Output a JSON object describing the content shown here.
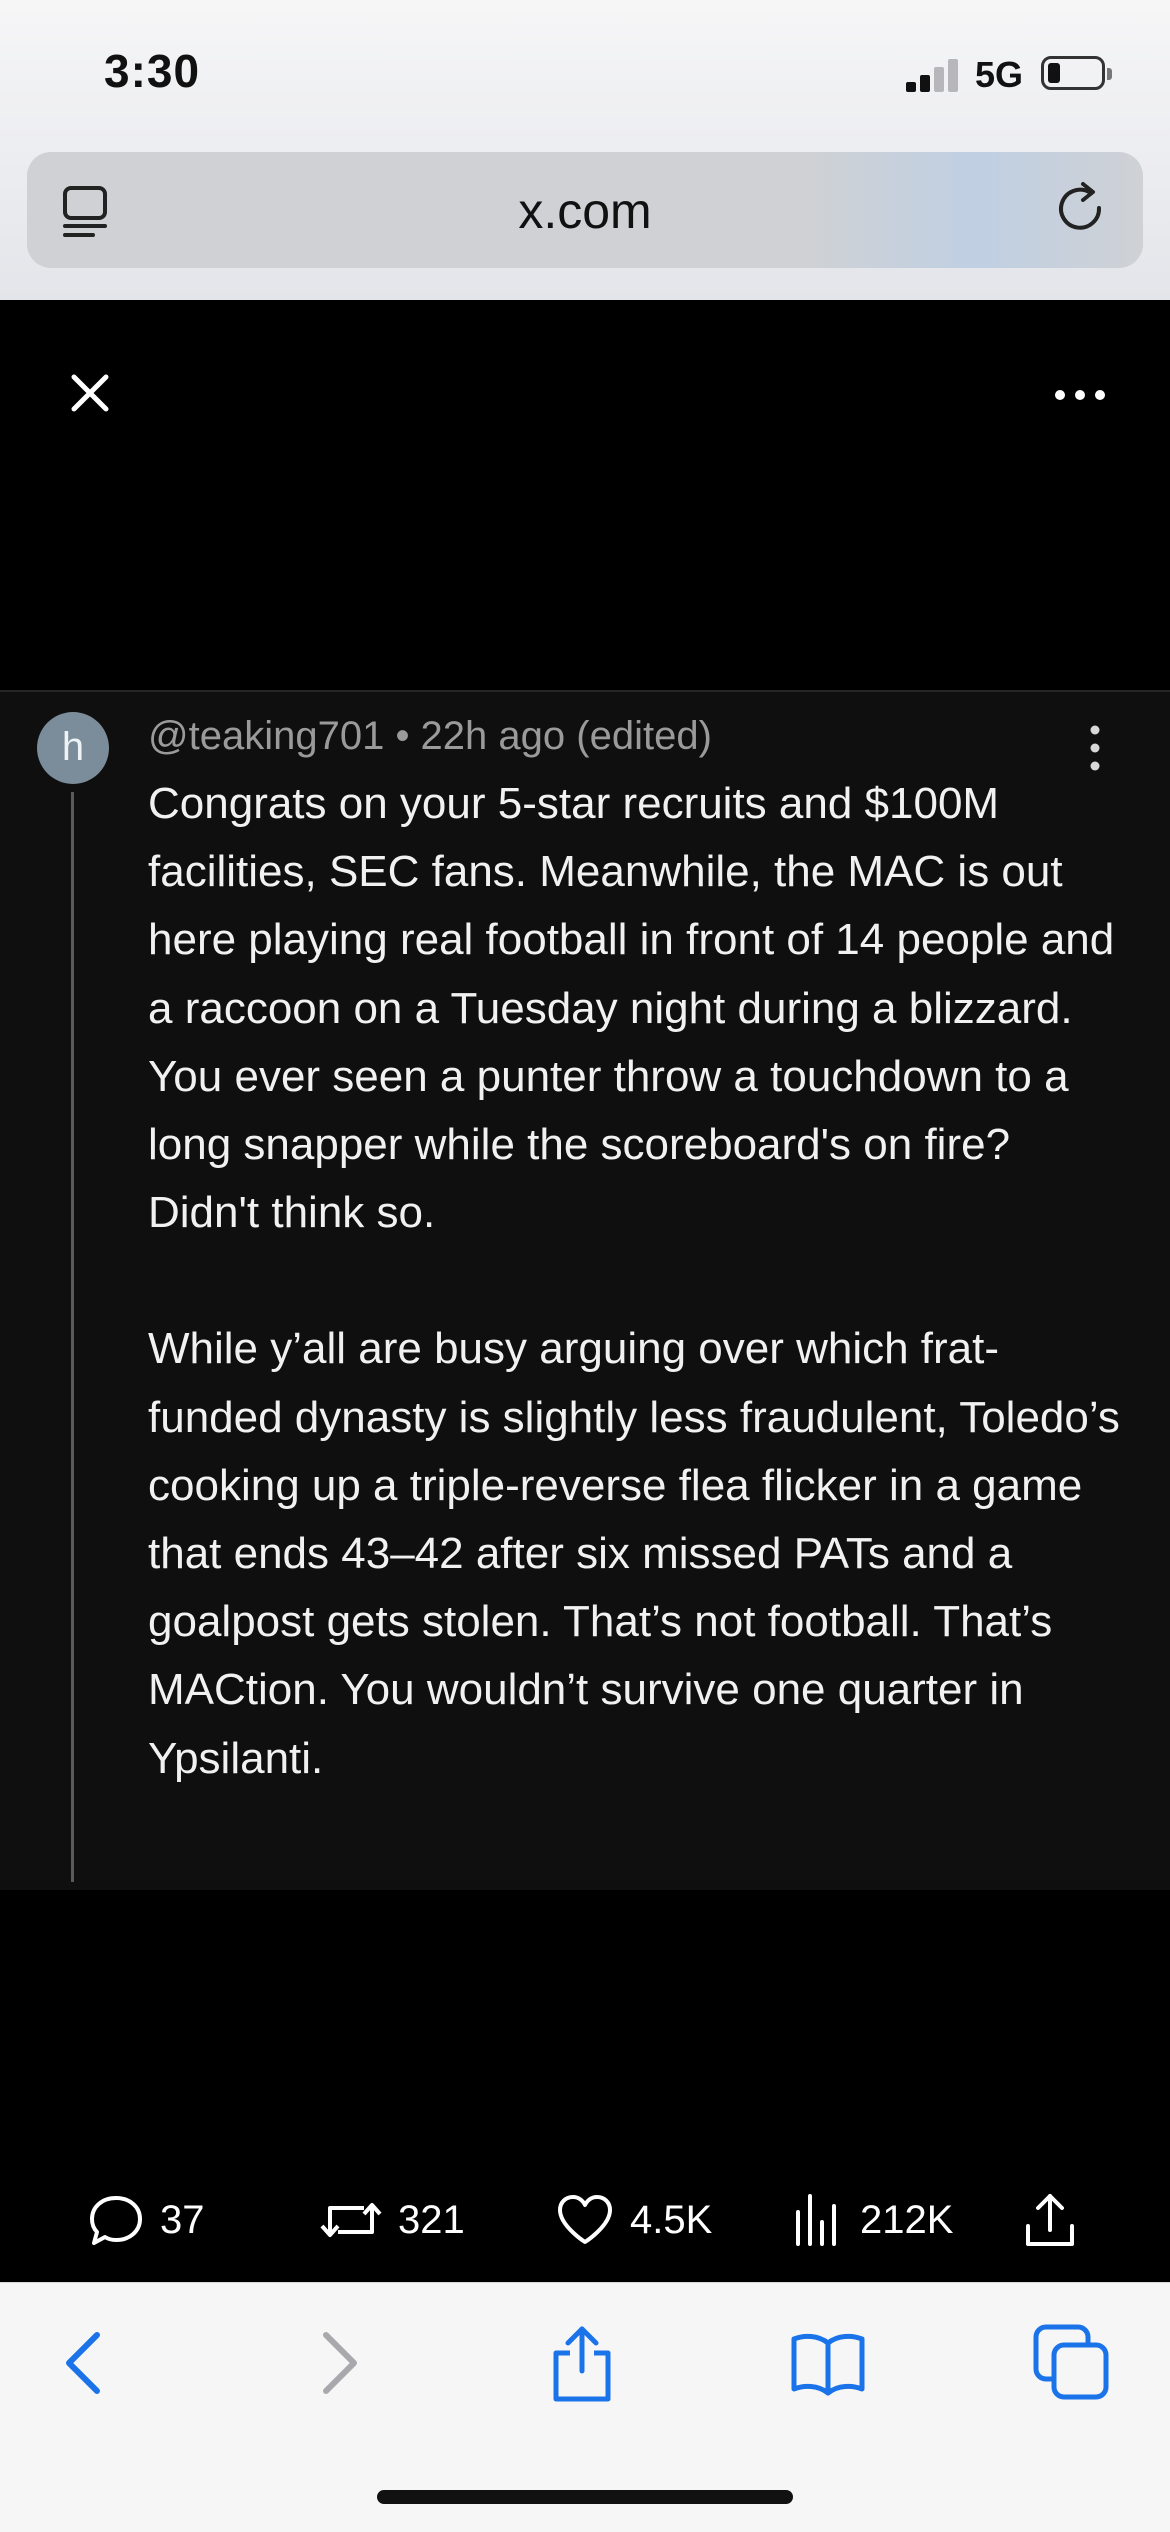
{
  "status_bar": {
    "time": "3:30",
    "network": "5G"
  },
  "browser": {
    "url": "x.com"
  },
  "comment": {
    "avatar_letter": "h",
    "meta": "@teaking701 • 22h ago (edited)",
    "paragraphs": [
      "Congrats on your 5-star recruits and $100M facilities, SEC fans. Meanwhile, the MAC is out here playing real football in front of 14 people and a raccoon on a Tuesday night during a blizzard. You ever seen a punter throw a touchdown to a long snapper while the scoreboard's on fire? Didn't think so.",
      "While y’all are busy arguing over which frat-funded dynasty is slightly less fraudulent, Toledo’s cooking up a triple-reverse flea flicker in a game that ends 43–42 after six missed PATs and a goalpost gets stolen. That’s not football. That’s MACtion. You wouldn’t survive one quarter in Ypsilanti."
    ]
  },
  "stats": {
    "replies": "37",
    "reposts": "321",
    "likes": "4.5K",
    "views": "212K"
  },
  "colors": {
    "toolbar_accent": "#1a73e8",
    "toolbar_disabled": "#a9a9ad"
  }
}
